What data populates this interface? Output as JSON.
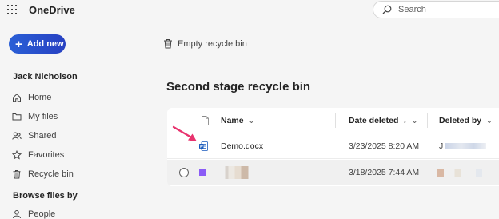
{
  "header": {
    "app_title": "OneDrive",
    "search_placeholder": "Search"
  },
  "sidebar": {
    "add_new_label": "Add new",
    "user_name": "Jack Nicholson",
    "items": [
      {
        "label": "Home",
        "icon": "home-icon"
      },
      {
        "label": "My files",
        "icon": "folder-icon"
      },
      {
        "label": "Shared",
        "icon": "people-icon"
      },
      {
        "label": "Favorites",
        "icon": "star-icon"
      },
      {
        "label": "Recycle bin",
        "icon": "trash-icon"
      }
    ],
    "browse_heading": "Browse files by",
    "browse_items": [
      {
        "label": "People",
        "icon": "person-icon"
      }
    ]
  },
  "main": {
    "empty_bin_label": "Empty recycle bin",
    "heading": "Second stage recycle bin",
    "columns": {
      "name": "Name",
      "date_deleted": "Date deleted",
      "date_sort_indicator": "↓",
      "deleted_by": "Deleted by"
    },
    "rows": [
      {
        "name": "Demo.docx",
        "date_deleted": "3/23/2025 8:20 AM",
        "deleted_by": "J"
      },
      {
        "name": "",
        "date_deleted": "3/18/2025 7:44 AM",
        "deleted_by": ""
      }
    ]
  },
  "colors": {
    "accent": "#2741c2",
    "annotation_arrow": "#e8336e",
    "word_blue": "#185abd"
  }
}
